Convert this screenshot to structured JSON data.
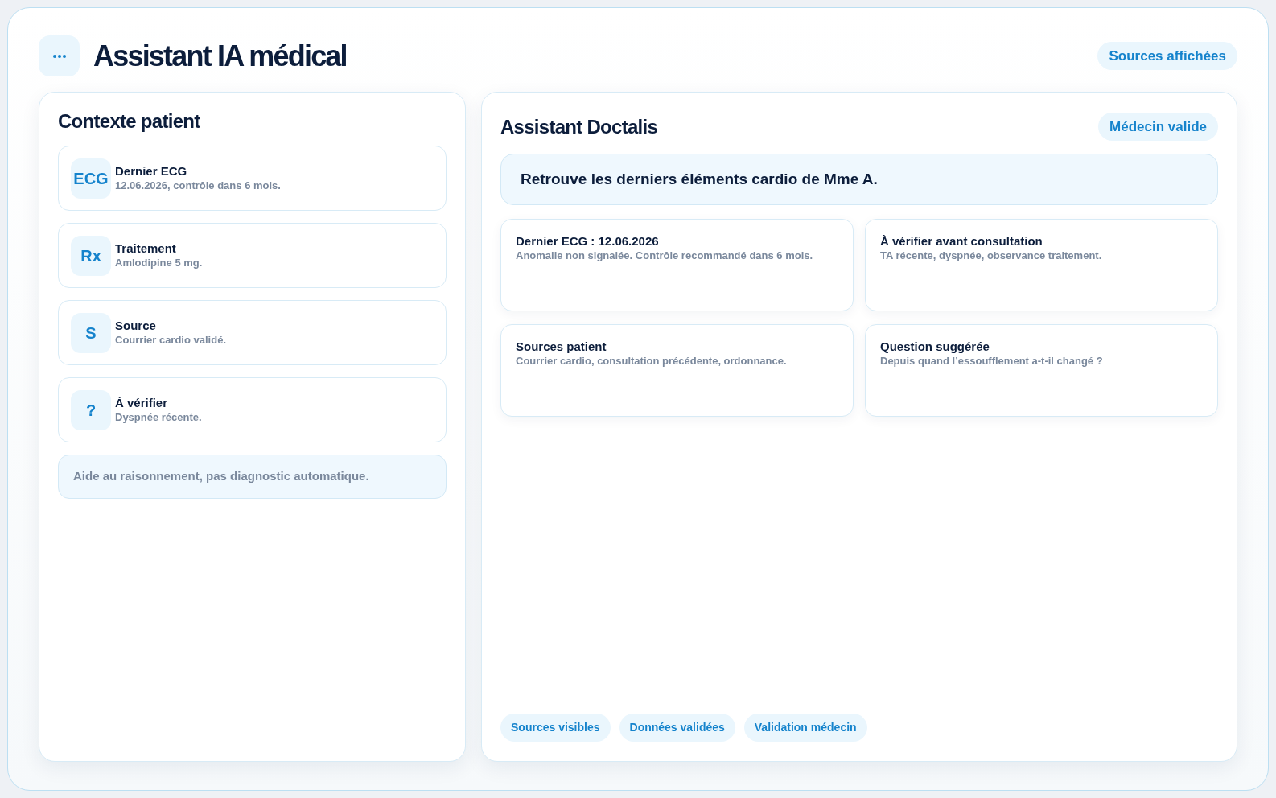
{
  "header": {
    "title": "Assistant IA médical",
    "badge": "Sources affichées"
  },
  "patient_context": {
    "title": "Contexte patient",
    "items": [
      {
        "tile": "ECG",
        "title": "Dernier ECG",
        "detail": "12.06.2026, contrôle dans 6 mois."
      },
      {
        "tile": "Rx",
        "title": "Traitement",
        "detail": "Amlodipine 5 mg."
      },
      {
        "tile": "S",
        "title": "Source",
        "detail": "Courrier cardio validé."
      },
      {
        "tile": "?",
        "title": "À vérifier",
        "detail": "Dyspnée récente."
      }
    ],
    "note": "Aide au raisonnement, pas diagnostic automatique."
  },
  "assistant": {
    "title": "Assistant Doctalis",
    "badge": "Médecin valide",
    "query": "Retrouve les derniers éléments cardio de Mme A.",
    "cards": [
      {
        "title": "Dernier ECG : 12.06.2026",
        "detail": "Anomalie non signalée. Contrôle recommandé dans 6 mois."
      },
      {
        "title": "À vérifier avant consultation",
        "detail": "TA récente, dyspnée, observance traitement."
      },
      {
        "title": "Sources patient",
        "detail": "Courrier cardio, consultation précédente, ordonnance."
      },
      {
        "title": "Question suggérée",
        "detail": "Depuis quand l’essoufflement a-t-il changé ?"
      }
    ],
    "chips": [
      "Sources visibles",
      "Données validées",
      "Validation médecin"
    ]
  }
}
